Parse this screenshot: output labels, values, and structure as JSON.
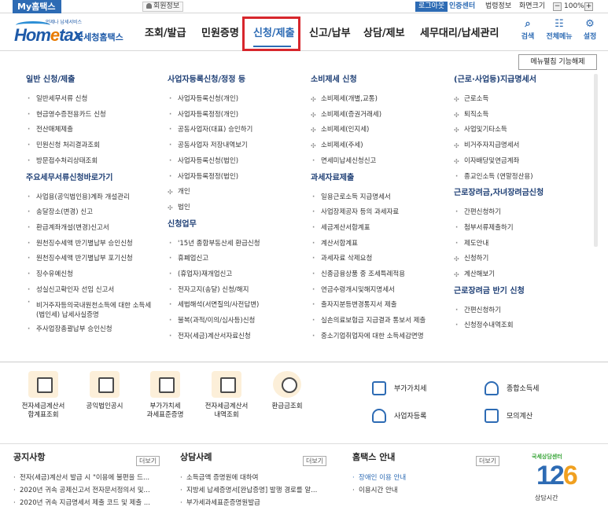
{
  "topbar": {
    "my_tab": "My홈택스",
    "member": "회원정보",
    "login": "로그아웃",
    "cert_center": "인증센터",
    "law": "법령정보",
    "zoom_label": "화면크기",
    "zoom_minus": "−",
    "zoom_value": "100%",
    "zoom_plus": "+"
  },
  "header": {
    "logo_small": "언제나 납세서비스",
    "logo_main_a": "Hom",
    "logo_main_e": "e",
    "logo_main_b": "tax",
    "logo_kr": "국세청홈택스",
    "nav": [
      "조회/발급",
      "민원증명",
      "신청/제출",
      "신고/납부",
      "상담/제보",
      "세무대리/납세관리"
    ],
    "active_index": 2,
    "tools": [
      {
        "label": "검색",
        "glyph": "⌕"
      },
      {
        "label": "전체메뉴",
        "glyph": "☷"
      },
      {
        "label": "설정",
        "glyph": "⚙"
      }
    ]
  },
  "megamenu": {
    "unfix_label": "메뉴펼침 기능해제",
    "col1": {
      "h1": "일반 신청/제출",
      "items1": [
        "일반세무서류 신청",
        "현금영수증전용카드 신청",
        "전산매체제출",
        "민원신청 처리결과조회",
        "방문접수처리상태조회"
      ],
      "h2": "주요세무서류신청바로가기",
      "items2": [
        "사업용(공익법인용)계좌 개설관리",
        "송달장소(변경) 신고",
        "환급계좌개설(변경)신고서",
        "원천징수세액 반기별납부 승인신청",
        "원천징수세액 반기별납부 포기신청",
        "징수유예신청",
        "성실신고확인자 선임 신고서",
        "비거주자등의국내원천소득에 대한 소득세(법인세) 납세사실증명",
        "주사업장총괄납부 승인신청"
      ]
    },
    "col2": {
      "h1": "사업자등록신청/정정 등",
      "items1": [
        "사업자등록신청(개인)",
        "사업자등록정정(개인)",
        "공동사업자(대표) 승인하기",
        "공동사업자 저장내역보기",
        "사업자등록신청(법인)",
        "사업자등록정정(법인)",
        "개인",
        "법인"
      ],
      "h2": "신청업무",
      "items2": [
        "'15년 종합부동산세 환급신청",
        "휴폐업신고",
        "(휴업자)재개업신고",
        "전자고지(송달) 신청/해지",
        "세법해석(서면질의/사전답변)",
        "불복(과적/이의/심사등)신청",
        "전자(세금)계산서자료신청"
      ]
    },
    "col3": {
      "h1": "소비제세 신청",
      "items1": [
        "소비제세(개별,교통)",
        "소비제세(증권거래세)",
        "소비제세(인지세)",
        "소비제세(주세)",
        "면세미납세신청신고"
      ],
      "h2": "과세자료제출",
      "items2": [
        "일용근로소득 지급명세서",
        "사업장제공자 등의 과세자료",
        "세금계산서합계표",
        "계산서합계표",
        "과세자료 삭제요청",
        "신종금융상품 중 조세특례적용",
        "연금수령개시및해지명세서",
        "출자지분등변경통지서 제출",
        "실손의료보험금 지급결과 통보서 제출",
        "중소기업취업자에 대한 소득세감면명"
      ]
    },
    "col4": {
      "h1": "(근로·사업등)지급명세서",
      "items1": [
        "근로소득",
        "퇴직소득",
        "사업및기타소득",
        "비거주자지급명세서",
        "이자배당및연금계좌",
        "종교인소득 (연말정산용)"
      ],
      "h2": "근로장려금,자녀장려금신청",
      "items2": [
        "간편신청하기",
        "첨부서류제출하기",
        "제도안내",
        "신청하기",
        "계산해보기"
      ],
      "h3": "근로장려금 반기 신청",
      "items3": [
        "간편신청하기",
        "신청정수내역조회"
      ]
    }
  },
  "quick": {
    "items": [
      {
        "label1": "전자세금계산서",
        "label2": "합계표조회"
      },
      {
        "label1": "공익법인공시",
        "label2": ""
      },
      {
        "label1": "부가가치세",
        "label2": "과세표준증명"
      },
      {
        "label1": "전자세금계산서",
        "label2": "내역조회"
      },
      {
        "label1": "환급금조회",
        "label2": ""
      }
    ],
    "services": [
      "부가가치세",
      "종합소득세",
      "사업자등록",
      "모의계산"
    ]
  },
  "boards": {
    "notice": {
      "title": "공지사항",
      "more": "더보기",
      "items": [
        "전자(세금)계산서 발급 시 \"이용에 불편을 드...",
        "2020년 귀속 공제신고서 전자문서정의서 및...",
        "2020년 귀속 지급명세서 제출 코드 및 제출 ..."
      ]
    },
    "cases": {
      "title": "상담사례",
      "more": "더보기",
      "items": [
        "소득금액 증명원에 대하여",
        "지방세 납세증명서[완납증명] 발행 경로를 알...",
        "부가세과세표준증명원발급"
      ]
    },
    "guide": {
      "title": "홈택스 안내",
      "more": "더보기",
      "items": [
        "장애인 이용 안내",
        "이용시간 안내"
      ]
    },
    "center": {
      "title": "국세상담센터",
      "num_a": "12",
      "num_b": "6",
      "time": "상담시간"
    }
  }
}
